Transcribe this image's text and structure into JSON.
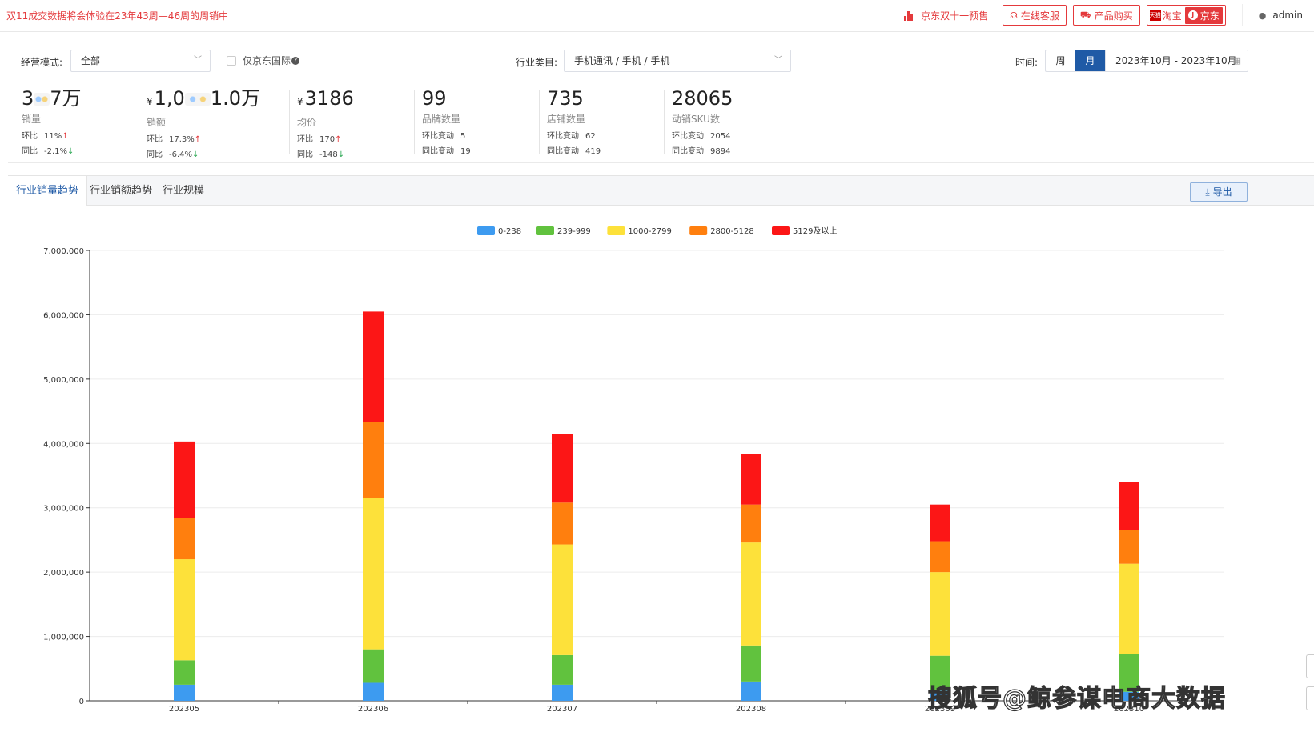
{
  "notice": "双11成交数据将会体验在23年43周—46周的周销中",
  "topbar": {
    "promo_label": "京东双十一预售",
    "service_label": "在线客服",
    "buy_label": "产品购买",
    "platform_taobao": "淘宝",
    "platform_taobao_badge": "天猫",
    "platform_jd": "京东",
    "user_name": "admin"
  },
  "filters": {
    "mode_label": "经营模式:",
    "mode_value": "全部",
    "jd_intl_label": "仅京东国际",
    "industry_label": "行业类目:",
    "industry_value": "手机通讯 / 手机 / 手机",
    "time_label": "时间:",
    "period_week": "周",
    "period_month": "月",
    "date_range": "2023年10月 - 2023年10月"
  },
  "kpis": [
    {
      "value_left": "3",
      "value_right": "7万",
      "currency": "",
      "name": "销量",
      "row1_label": "环比",
      "row1_value": "11%",
      "row1_dir": "↑",
      "row2_label": "同比",
      "row2_value": "-2.1%",
      "row2_dir": "↓"
    },
    {
      "value_left": "1,0",
      "value_right": "1.0万",
      "currency": "¥",
      "name": "销额",
      "row1_label": "环比",
      "row1_value": "17.3%",
      "row1_dir": "↑",
      "row2_label": "同比",
      "row2_value": "-6.4%",
      "row2_dir": "↓"
    },
    {
      "value_left": "3186",
      "value_right": "",
      "currency": "¥",
      "name": "均价",
      "row1_label": "环比",
      "row1_value": "170",
      "row1_dir": "↑",
      "row2_label": "同比",
      "row2_value": "-148",
      "row2_dir": "↓"
    },
    {
      "value_left": "99",
      "value_right": "",
      "currency": "",
      "name": "品牌数量",
      "row1_label": "环比变动",
      "row1_value": "5",
      "row1_dir": "",
      "row2_label": "同比变动",
      "row2_value": "19",
      "row2_dir": ""
    },
    {
      "value_left": "735",
      "value_right": "",
      "currency": "",
      "name": "店铺数量",
      "row1_label": "环比变动",
      "row1_value": "62",
      "row1_dir": "",
      "row2_label": "同比变动",
      "row2_value": "419",
      "row2_dir": ""
    },
    {
      "value_left": "28065",
      "value_right": "",
      "currency": "",
      "name": "动销SKU数",
      "row1_label": "环比变动",
      "row1_value": "2054",
      "row1_dir": "",
      "row2_label": "同比变动",
      "row2_value": "9894",
      "row2_dir": ""
    }
  ],
  "tabs": [
    "行业销量趋势",
    "行业销额趋势",
    "行业规模"
  ],
  "export_label": "导出",
  "watermark": "搜狐号@鲸参谋电商大数据",
  "colors": {
    "primary": "#1f5aa6",
    "alert": "#e4393c"
  },
  "chart_data": {
    "type": "bar",
    "stacked": true,
    "title": "",
    "xlabel": "",
    "ylabel": "",
    "ylim": [
      0,
      7000000
    ],
    "yticks": [
      0,
      1000000,
      2000000,
      3000000,
      4000000,
      5000000,
      6000000,
      7000000
    ],
    "ytick_labels": [
      "0",
      "1,000,000",
      "2,000,000",
      "3,000,000",
      "4,000,000",
      "5,000,000",
      "6,000,000",
      "7,000,000"
    ],
    "grid": true,
    "legend_position": "top-center",
    "categories": [
      "202305",
      "202306",
      "202307",
      "202308",
      "202309",
      "202310"
    ],
    "series": [
      {
        "name": "0-238",
        "color": "#3d9bf0",
        "values": [
          250000,
          280000,
          250000,
          300000,
          160000,
          140000
        ]
      },
      {
        "name": "239-999",
        "color": "#61c23e",
        "values": [
          380000,
          520000,
          460000,
          560000,
          540000,
          590000
        ]
      },
      {
        "name": "1000-2799",
        "color": "#fde13a",
        "values": [
          1570000,
          2350000,
          1720000,
          1600000,
          1300000,
          1400000
        ]
      },
      {
        "name": "2800-5128",
        "color": "#ff7f0e",
        "values": [
          640000,
          1180000,
          650000,
          590000,
          480000,
          530000
        ]
      },
      {
        "name": "5129及以上",
        "color": "#fc1616",
        "values": [
          1190000,
          1720000,
          1070000,
          790000,
          570000,
          740000
        ]
      }
    ]
  }
}
